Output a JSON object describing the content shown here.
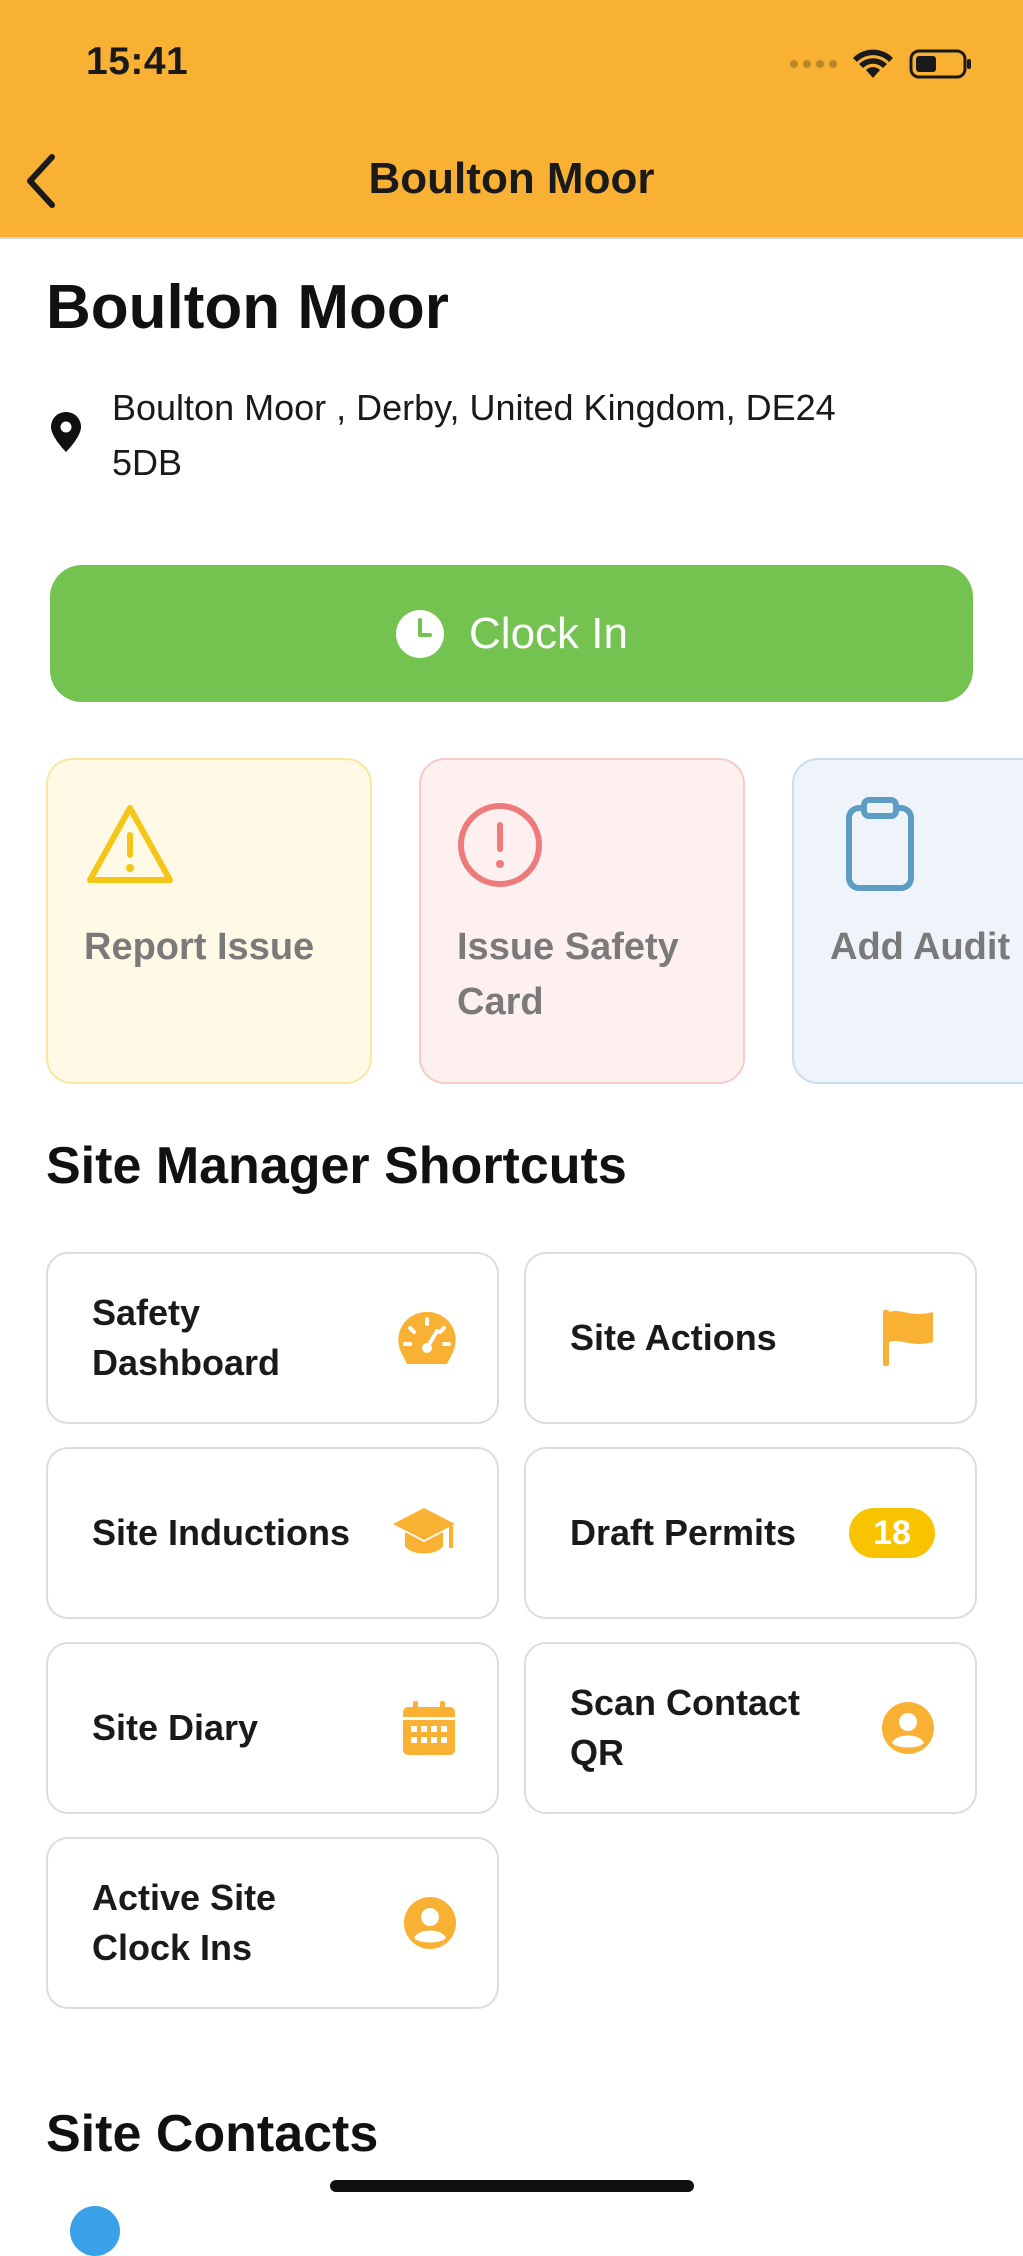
{
  "status_bar": {
    "time": "15:41"
  },
  "nav": {
    "title": "Boulton Moor"
  },
  "site": {
    "name": "Boulton Moor",
    "address_line1": "Boulton Moor , Derby, United Kingdom, DE24",
    "address_line2": "5DB"
  },
  "clock_in": {
    "label": "Clock In"
  },
  "action_cards": [
    {
      "label": "Report Issue",
      "icon": "warning-triangle-icon",
      "color": "#F5C518"
    },
    {
      "label_line1": "Issue Safety",
      "label_line2": "Card",
      "icon": "exclamation-circle-icon",
      "color": "#EE7B7B"
    },
    {
      "label": "Add Audit",
      "icon": "clipboard-icon",
      "color": "#5D9CC4"
    }
  ],
  "shortcuts": {
    "heading": "Site Manager Shortcuts",
    "items": [
      {
        "label_line1": "Safety",
        "label_line2": "Dashboard",
        "icon": "speedometer-icon"
      },
      {
        "label": "Site Actions",
        "icon": "flag-icon"
      },
      {
        "label": "Site Inductions",
        "icon": "graduation-cap-icon"
      },
      {
        "label": "Draft Permits",
        "badge": "18"
      },
      {
        "label": "Site Diary",
        "icon": "calendar-icon"
      },
      {
        "label_line1": "Scan Contact",
        "label_line2": "QR",
        "icon": "user-circle-icon"
      },
      {
        "label_line1": "Active Site",
        "label_line2": "Clock Ins",
        "icon": "user-circle-icon"
      }
    ]
  },
  "contacts": {
    "heading": "Site Contacts"
  },
  "colors": {
    "header": "#F8B133",
    "clock_in": "#74C24F",
    "accent": "#F8B133",
    "badge": "#F8C400"
  }
}
